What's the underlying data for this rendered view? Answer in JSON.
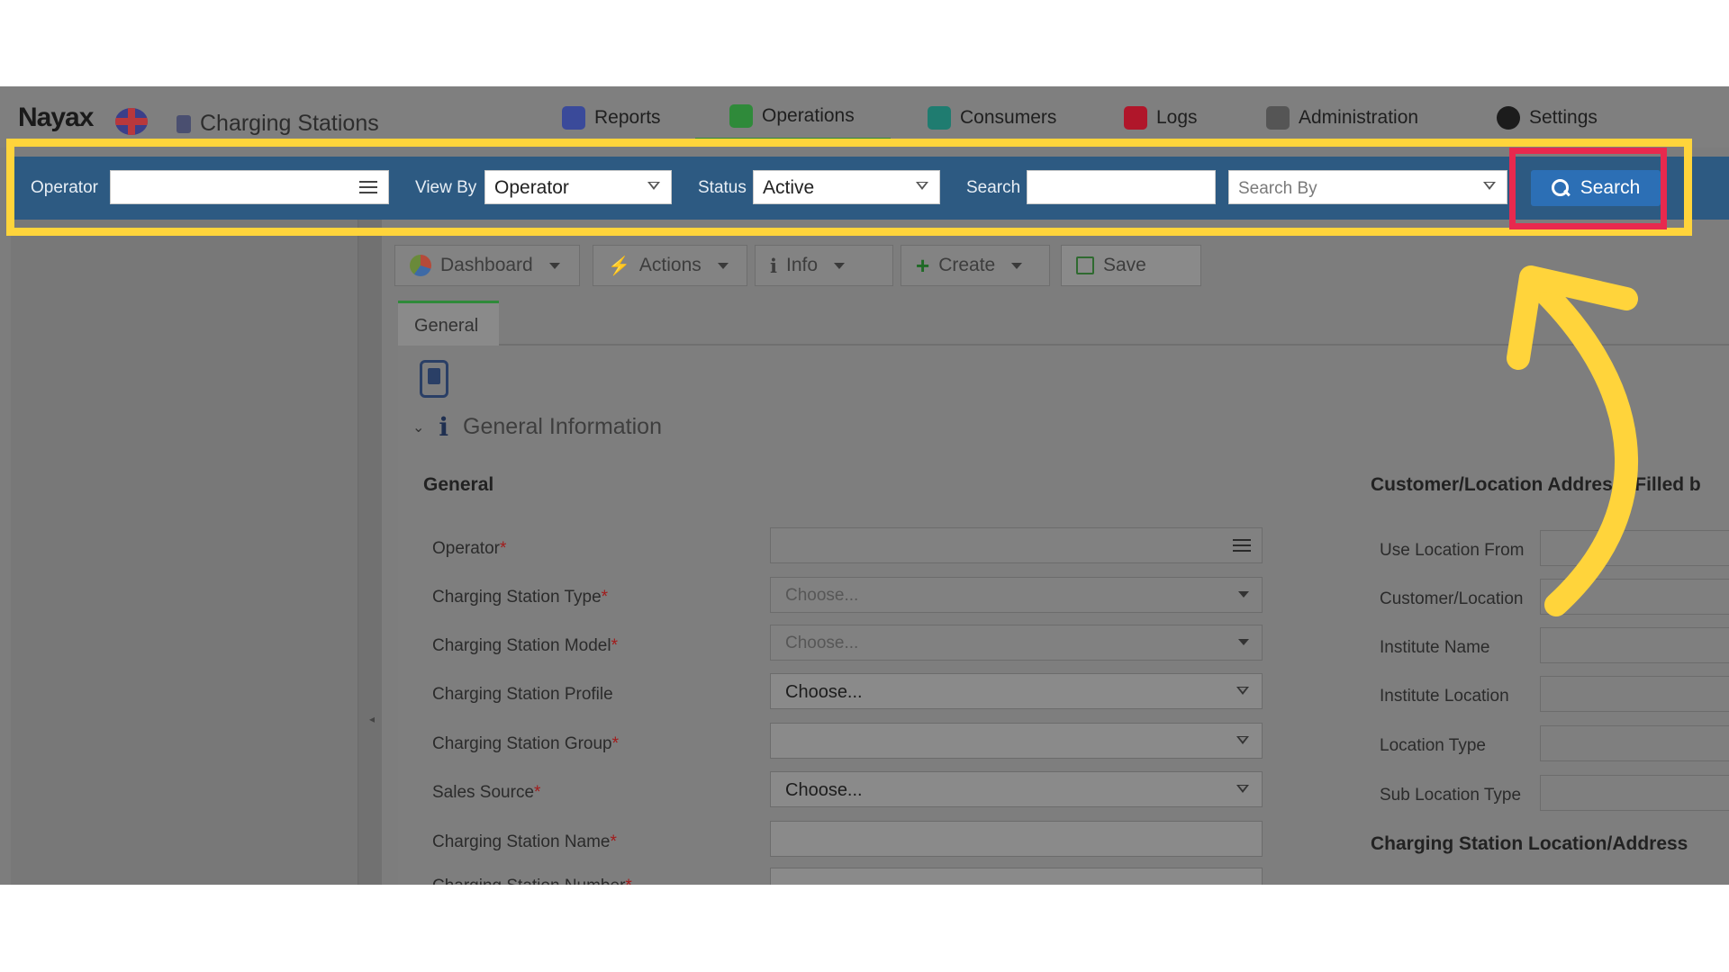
{
  "header": {
    "brand": "Nayax",
    "app_title": "Charging Stations",
    "nav": [
      {
        "label": "Reports",
        "icon": "reports-icon",
        "color": "#3a4a9a"
      },
      {
        "label": "Operations",
        "icon": "operations-icon",
        "color": "#2f8a3a"
      },
      {
        "label": "Consumers",
        "icon": "consumers-icon",
        "color": "#1f7c70"
      },
      {
        "label": "Logs",
        "icon": "logs-icon",
        "color": "#b0162a"
      },
      {
        "label": "Administration",
        "icon": "administration-icon",
        "color": "#555555"
      },
      {
        "label": "Settings",
        "icon": "settings-icon",
        "color": "#1c1c1c"
      }
    ]
  },
  "filter_bar": {
    "operator_label": "Operator",
    "operator_value": "",
    "view_by_label": "View By",
    "view_by_value": "Operator",
    "status_label": "Status",
    "status_value": "Active",
    "search_label": "Search",
    "search_value": "",
    "search_by_placeholder": "Search By",
    "search_button": "Search"
  },
  "toolbar": {
    "dashboard": "Dashboard",
    "actions": "Actions",
    "info": "Info",
    "create": "Create",
    "save": "Save"
  },
  "tabs": {
    "general": "General"
  },
  "section": {
    "title": "General Information",
    "left_group": "General",
    "right_group": "Customer/Location Address (Filled b",
    "right_group2": "Charging Station Location/Address"
  },
  "form": {
    "fields": [
      {
        "label": "Operator",
        "required": "*",
        "value": "",
        "type": "list"
      },
      {
        "label": "Charging Station Type",
        "required": "*",
        "value": "Choose...",
        "type": "select"
      },
      {
        "label": "Charging Station Model",
        "required": "*",
        "value": "Choose...",
        "type": "select"
      },
      {
        "label": "Charging Station Profile",
        "required": "",
        "value": "Choose...",
        "type": "dropdown"
      },
      {
        "label": "Charging Station Group",
        "required": "*",
        "value": "",
        "type": "dropdown"
      },
      {
        "label": "Sales Source",
        "required": "*",
        "value": "Choose...",
        "type": "dropdown"
      },
      {
        "label": "Charging Station Name",
        "required": "*",
        "value": "",
        "type": "text"
      },
      {
        "label": "Charging Station Number",
        "required": "*",
        "value": "",
        "type": "text"
      }
    ],
    "right_fields": [
      {
        "label": "Use Location From"
      },
      {
        "label": "Customer/Location"
      },
      {
        "label": "Institute Name"
      },
      {
        "label": "Institute Location"
      },
      {
        "label": "Location Type"
      },
      {
        "label": "Sub Location Type"
      }
    ]
  },
  "colors": {
    "filter_bar": "#2d5a82",
    "search_button": "#2c6fb5",
    "highlight_yellow": "#ffd43b",
    "highlight_red": "#e8294e",
    "arrow": "#ffd43b"
  }
}
